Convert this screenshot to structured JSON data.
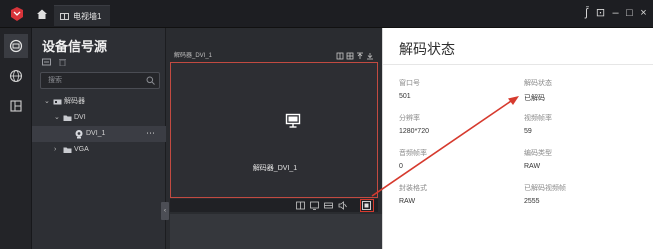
{
  "window": {
    "tab_title": "电视墙1",
    "controls": [
      "ʃ̄",
      "⊡",
      "–",
      "□",
      "×"
    ]
  },
  "sidebar": {
    "title": "设备信号源",
    "search_placeholder": "搜索",
    "tree": [
      {
        "label": "解码器",
        "level": 0,
        "expanded": true
      },
      {
        "label": "DVI",
        "level": 1,
        "expanded": true
      },
      {
        "label": "DVI_1",
        "level": 2,
        "selected": true,
        "more": "⋯"
      },
      {
        "label": "VGA",
        "level": 1,
        "expanded": false
      }
    ]
  },
  "player": {
    "window_title": "解码器_DVI_1",
    "video_label": "解码器_DVI_1",
    "collapse_glyph": "‹"
  },
  "decode_panel": {
    "title": "解码状态",
    "fields": [
      {
        "label": "窗口号",
        "value": "501"
      },
      {
        "label": "解码状态",
        "value": "已解码"
      },
      {
        "label": "分辨率",
        "value": "1280*720"
      },
      {
        "label": "视频帧率",
        "value": "59"
      },
      {
        "label": "音频帧率",
        "value": "0"
      },
      {
        "label": "编码类型",
        "value": "RAW"
      },
      {
        "label": "封装格式",
        "value": "RAW"
      },
      {
        "label": "已解码视频帧",
        "value": "2555"
      }
    ]
  },
  "colors": {
    "accent_red": "#d63a2e",
    "dark_bg": "#2b2d31",
    "panel_bg": "#ffffff"
  }
}
